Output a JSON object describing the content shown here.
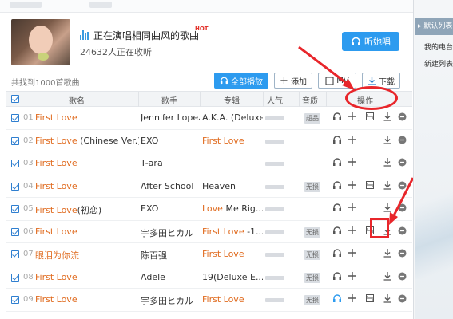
{
  "header": {
    "now_playing_title": "正在演唱相同曲风的歌曲",
    "hot_badge": "HOT",
    "listeners_text": "24632人正在收听",
    "listen_button_label": "听她唱"
  },
  "toolbar": {
    "found_text": "共找到1000首歌曲",
    "play_all_label": "全部播放",
    "add_label": "添加",
    "mv_label": "MV",
    "download_label": "下载"
  },
  "table": {
    "columns": [
      "歌名",
      "歌手",
      "专辑",
      "人气",
      "音质",
      "操作"
    ],
    "rows": [
      {
        "num": "01",
        "name": "First Love",
        "name_extra": "",
        "singer": "Jennifer Lopez",
        "album": "A.K.A. (Deluxe)",
        "album_highlight": "",
        "quality": "超品",
        "has_mv": true
      },
      {
        "num": "02",
        "name": "First Love",
        "name_extra": " (Chinese Ver.)",
        "singer": "EXO",
        "album": "",
        "album_highlight": "First Love",
        "quality": "",
        "has_mv": false
      },
      {
        "num": "03",
        "name": "First Love",
        "name_extra": "",
        "singer": "T-ara",
        "album": "",
        "album_highlight": "",
        "quality": "",
        "has_mv": false
      },
      {
        "num": "04",
        "name": "First Love",
        "name_extra": "",
        "singer": "After School",
        "album": "Heaven",
        "album_highlight": "",
        "quality": "无损",
        "has_mv": true
      },
      {
        "num": "05",
        "name": "First Love",
        "name_extra": "(初恋)",
        "singer": "EXO",
        "album": " Me Rig...",
        "album_highlight": "Love",
        "quality": "",
        "has_mv": false
      },
      {
        "num": "06",
        "name": "First Love",
        "name_extra": "",
        "singer": "宇多田ヒカル",
        "album": " -1...",
        "album_highlight": "First Love",
        "quality": "无损",
        "has_mv": true
      },
      {
        "num": "07",
        "name": "眼泪为你流",
        "name_extra": "",
        "singer": "陈百强",
        "album": "",
        "album_highlight": "First Love",
        "quality": "无损",
        "has_mv": false
      },
      {
        "num": "08",
        "name": "First Love",
        "name_extra": "",
        "singer": "Adele",
        "album": "19(Deluxe E...",
        "album_highlight": "",
        "quality": "无损",
        "has_mv": false
      },
      {
        "num": "09",
        "name": "First Love",
        "name_extra": "",
        "singer": "宇多田ヒカル",
        "album": "",
        "album_highlight": "First Love",
        "quality": "无损",
        "has_mv": true
      }
    ]
  },
  "sidebar": {
    "selected_label": "默认列表",
    "items": [
      "我的电台",
      "新建列表"
    ]
  },
  "colors": {
    "accent": "#2d9bef",
    "highlight": "#e06b1f",
    "annotation": "#e8262b"
  }
}
